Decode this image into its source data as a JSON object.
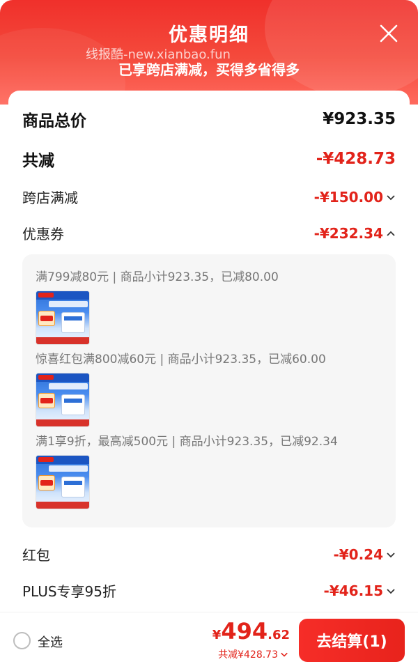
{
  "header": {
    "title": "优惠明细",
    "watermark": "线报酷-new.xianbao.fun",
    "subtitle": "已享跨店满减，买得多省得多"
  },
  "summary": {
    "goods_total_label": "商品总价",
    "goods_total_value": "¥923.35",
    "total_discount_label": "共减",
    "total_discount_value": "-¥428.73",
    "cross_store_label": "跨店满减",
    "cross_store_value": "-¥150.00",
    "coupon_label": "优惠券",
    "coupon_value": "-¥232.34",
    "red_packet_label": "红包",
    "red_packet_value": "-¥0.24",
    "plus_label": "PLUS专享95折",
    "plus_value": "-¥46.15"
  },
  "coupons": [
    {
      "text": "满799减80元 | 商品小计923.35，已减80.00"
    },
    {
      "text": "惊喜红包满800减60元 | 商品小计923.35，已减60.00"
    },
    {
      "text": "满1享9折，最高减500元 | 商品小计923.35，已减92.34"
    }
  ],
  "footer": {
    "select_all": "全选",
    "price_currency": "¥",
    "price_int": "494",
    "price_dec": ".62",
    "saved_text": "共减¥428.73",
    "checkout_label": "去结算(1)"
  },
  "colors": {
    "accent_red": "#e2231a",
    "header_red": "#f0302b",
    "coupon_bg": "#f6f6f6"
  },
  "icons": [
    "close-icon",
    "chevron-down-icon",
    "chevron-up-icon",
    "radio-icon"
  ]
}
